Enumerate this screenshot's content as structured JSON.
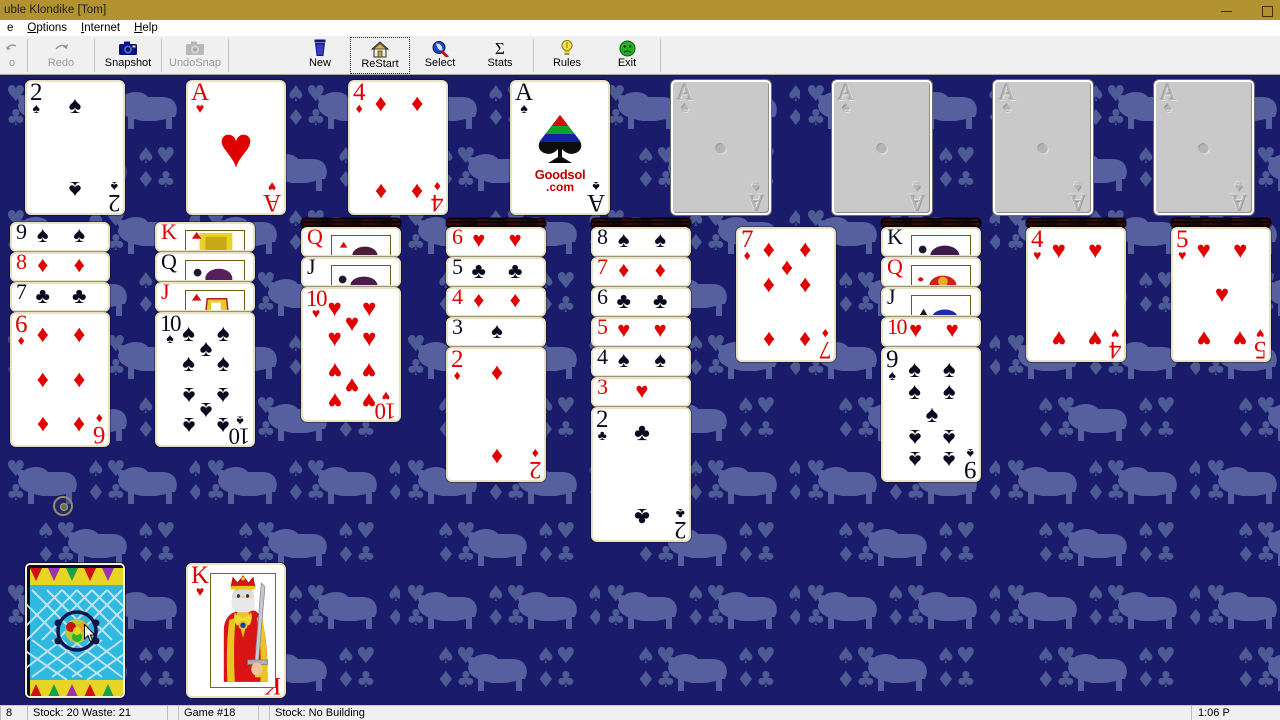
{
  "window": {
    "title": "uble Klondike [Tom]",
    "minimize_label": "minimize",
    "maximize_label": "maximize"
  },
  "menu": {
    "items": [
      {
        "label": "e",
        "mnemonic": ""
      },
      {
        "label": "Options",
        "mnemonic": "O"
      },
      {
        "label": "Internet",
        "mnemonic": "I"
      },
      {
        "label": "Help",
        "mnemonic": "H"
      }
    ]
  },
  "toolbar": {
    "buttons": [
      {
        "name": "undo",
        "label": "o",
        "icon": "undo-icon",
        "disabled": true,
        "focused": false
      },
      {
        "name": "redo",
        "label": "Redo",
        "icon": "redo-icon",
        "disabled": true,
        "focused": false
      },
      {
        "name": "snapshot",
        "label": "Snapshot",
        "icon": "camera-icon",
        "disabled": false,
        "focused": false
      },
      {
        "name": "undosnap",
        "label": "UndoSnap",
        "icon": "undosnap-icon",
        "disabled": true,
        "focused": false
      },
      {
        "name": "new",
        "label": "New",
        "icon": "deal-icon",
        "disabled": false,
        "focused": false
      },
      {
        "name": "restart",
        "label": "ReStart",
        "icon": "house-icon",
        "disabled": false,
        "focused": true
      },
      {
        "name": "select",
        "label": "Select",
        "icon": "magnifier-icon",
        "disabled": false,
        "focused": false
      },
      {
        "name": "stats",
        "label": "Stats",
        "icon": "sigma-icon",
        "disabled": false,
        "focused": false
      },
      {
        "name": "rules",
        "label": "Rules",
        "icon": "lightbulb-icon",
        "disabled": false,
        "focused": false
      },
      {
        "name": "exit",
        "label": "Exit",
        "icon": "face-icon",
        "disabled": false,
        "focused": false
      }
    ]
  },
  "statusbar": {
    "score": "8",
    "stock_waste": "Stock: 20   Waste: 21",
    "game_number": "Game #18",
    "hint": "Stock: No Building",
    "clock": "1:06 P"
  },
  "colors": {
    "table_background": "#1b1b6b",
    "pattern_accent": "#7f8fc0",
    "titlebar": "#b29330",
    "card_border": "#e8e2c0",
    "red_suit": "#e00000",
    "black_suit": "#0a0a1e"
  },
  "board": {
    "foundations": [
      {
        "slot": 1,
        "empty": false,
        "rank": "2",
        "suit": "spades",
        "color": "black",
        "logo": false
      },
      {
        "slot": 2,
        "empty": false,
        "rank": "A",
        "suit": "hearts",
        "color": "red",
        "logo": false
      },
      {
        "slot": 3,
        "empty": false,
        "rank": "4",
        "suit": "diamonds",
        "color": "red",
        "logo": false
      },
      {
        "slot": 4,
        "empty": false,
        "rank": "A",
        "suit": "spades",
        "color": "black",
        "logo": true,
        "logo_line1": "Goodsol",
        "logo_line2": ".com"
      },
      {
        "slot": 5,
        "empty": true,
        "ghost_rank": "A",
        "ghost_suit": "spades"
      },
      {
        "slot": 6,
        "empty": true,
        "ghost_rank": "A",
        "ghost_suit": "spades"
      },
      {
        "slot": 7,
        "empty": true,
        "ghost_rank": "A",
        "ghost_suit": "spades"
      },
      {
        "slot": 8,
        "empty": true,
        "ghost_rank": "A",
        "ghost_suit": "spades"
      }
    ],
    "tableau": [
      {
        "column": 1,
        "facedown": 0,
        "cards": [
          {
            "rank": "9",
            "suit": "spades",
            "color": "black",
            "covered": true
          },
          {
            "rank": "8",
            "suit": "diamonds",
            "color": "red",
            "covered": true
          },
          {
            "rank": "7",
            "suit": "clubs",
            "color": "black",
            "covered": true
          },
          {
            "rank": "6",
            "suit": "diamonds",
            "color": "red",
            "covered": false
          }
        ]
      },
      {
        "column": 2,
        "facedown": 0,
        "cards": [
          {
            "rank": "K",
            "suit": "diamonds",
            "color": "red",
            "covered": true,
            "court": true
          },
          {
            "rank": "Q",
            "suit": "clubs",
            "color": "black",
            "covered": true,
            "court": true
          },
          {
            "rank": "J",
            "suit": "diamonds",
            "color": "red",
            "covered": true,
            "court": true
          },
          {
            "rank": "10",
            "suit": "spades",
            "color": "black",
            "covered": false
          }
        ]
      },
      {
        "column": 3,
        "facedown": 1,
        "cards": [
          {
            "rank": "Q",
            "suit": "diamonds",
            "color": "red",
            "covered": true,
            "court": true
          },
          {
            "rank": "J",
            "suit": "spades",
            "color": "black",
            "covered": true,
            "court": true
          },
          {
            "rank": "10",
            "suit": "hearts",
            "color": "red",
            "covered": false
          }
        ]
      },
      {
        "column": 4,
        "facedown": 1,
        "cards": [
          {
            "rank": "6",
            "suit": "hearts",
            "color": "red",
            "covered": true
          },
          {
            "rank": "5",
            "suit": "clubs",
            "color": "black",
            "covered": true
          },
          {
            "rank": "4",
            "suit": "diamonds",
            "color": "red",
            "covered": true
          },
          {
            "rank": "3",
            "suit": "spades",
            "color": "black",
            "covered": true
          },
          {
            "rank": "2",
            "suit": "diamonds",
            "color": "red",
            "covered": false
          }
        ]
      },
      {
        "column": 5,
        "facedown": 1,
        "cards": [
          {
            "rank": "8",
            "suit": "spades",
            "color": "black",
            "covered": true
          },
          {
            "rank": "7",
            "suit": "diamonds",
            "color": "red",
            "covered": true
          },
          {
            "rank": "6",
            "suit": "clubs",
            "color": "black",
            "covered": true
          },
          {
            "rank": "5",
            "suit": "hearts",
            "color": "red",
            "covered": true
          },
          {
            "rank": "4",
            "suit": "spades",
            "color": "black",
            "covered": true
          },
          {
            "rank": "3",
            "suit": "hearts",
            "color": "red",
            "covered": true
          },
          {
            "rank": "2",
            "suit": "clubs",
            "color": "black",
            "covered": false
          }
        ]
      },
      {
        "column": 6,
        "facedown": 0,
        "cards": [
          {
            "rank": "7",
            "suit": "diamonds",
            "color": "red",
            "covered": false
          }
        ]
      },
      {
        "column": 7,
        "facedown": 1,
        "cards": [
          {
            "rank": "K",
            "suit": "spades",
            "color": "black",
            "covered": true,
            "court": true
          },
          {
            "rank": "Q",
            "suit": "hearts",
            "color": "red",
            "covered": true,
            "court": true
          },
          {
            "rank": "J",
            "suit": "spades",
            "color": "black",
            "covered": true,
            "court": true
          },
          {
            "rank": "10",
            "suit": "hearts",
            "color": "red",
            "covered": true
          },
          {
            "rank": "9",
            "suit": "spades",
            "color": "black",
            "covered": false
          }
        ]
      },
      {
        "column": 8,
        "facedown": 1,
        "cards": [
          {
            "rank": "4",
            "suit": "hearts",
            "color": "red",
            "covered": false
          }
        ]
      },
      {
        "column": 9,
        "facedown": 1,
        "cards": [
          {
            "rank": "5",
            "suit": "hearts",
            "color": "red",
            "covered": false
          }
        ]
      }
    ],
    "stock": {
      "name": "stock-pile",
      "face_down": true,
      "back_design": "blue-lattice"
    },
    "waste": {
      "name": "waste-pile",
      "rank": "K",
      "suit": "hearts",
      "color": "red",
      "court": true
    }
  }
}
